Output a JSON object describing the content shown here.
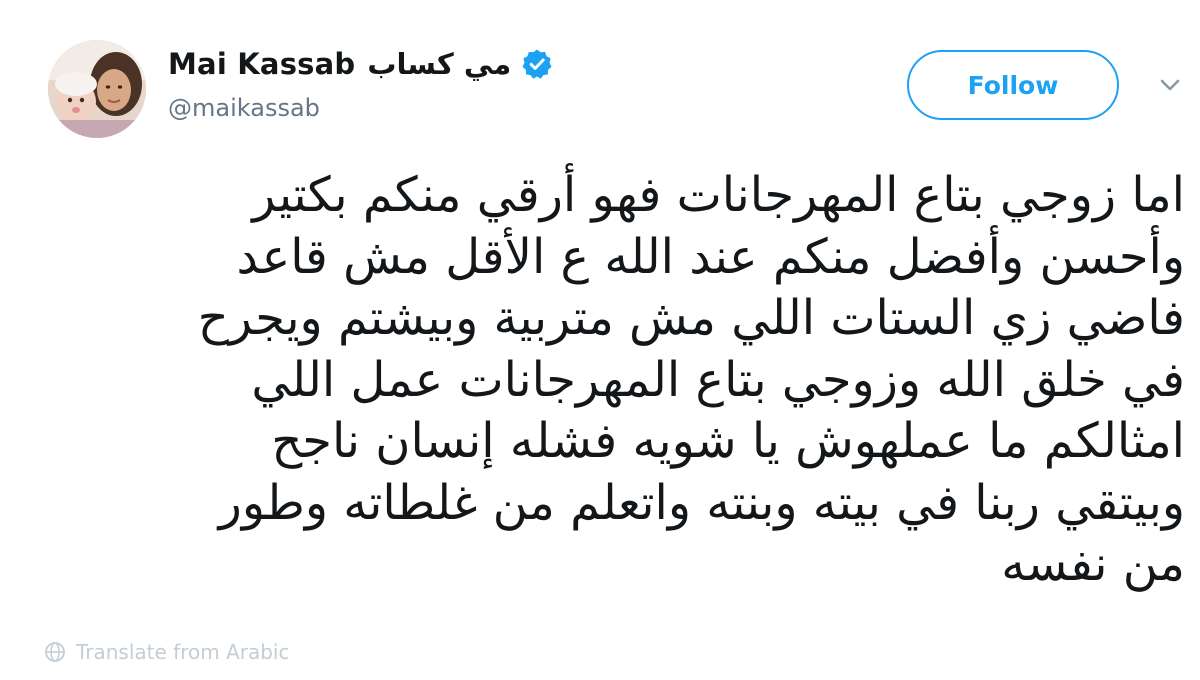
{
  "author": {
    "name": "Mai Kassab",
    "name_arabic": "مي كساب",
    "handle": "@maikassab",
    "verified": true
  },
  "actions": {
    "follow_label": "Follow",
    "more_icon": "chevron-down-icon"
  },
  "tweet": {
    "lines": [
      "اما زوجي بتاع المهرجانات فهو أرقي منكم بكتير",
      "وأحسن وأفضل منكم عند الله ع الأقل مش قاعد",
      "فاضي زي الستات اللي مش متربية وبيشتم ويجرح",
      "في خلق الله وزوجي بتاع المهرجانات عمل اللي",
      "امثالكم ما عملهوش يا شويه فشله إنسان ناجح",
      "وبيتقي ربنا في بيته وبنته واتعلم من غلطاته وطور",
      "من نفسه"
    ]
  },
  "footer": {
    "translate_label": "Translate from Arabic",
    "translate_icon": "globe-icon"
  },
  "colors": {
    "accent": "#1da1f2",
    "text": "#14171a",
    "muted": "#657786"
  }
}
